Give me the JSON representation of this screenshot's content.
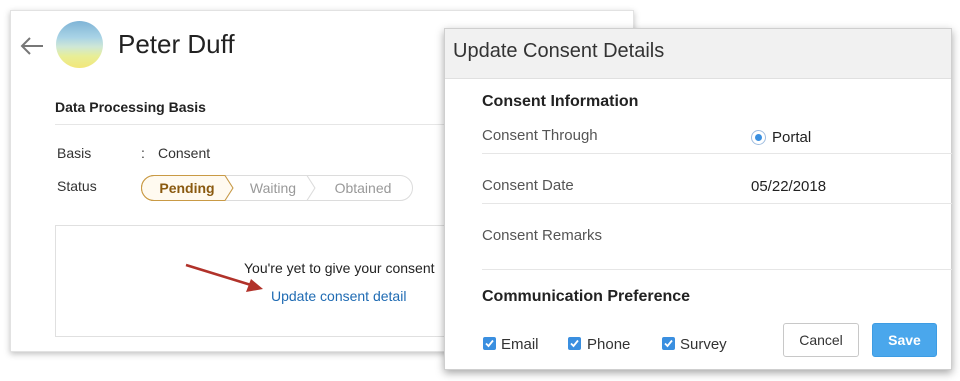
{
  "profile": {
    "name": "Peter Duff",
    "section_title": "Data Processing Basis",
    "basis_label": "Basis",
    "basis_colon": ":",
    "basis_value": "Consent",
    "status_label": "Status",
    "status_stages": [
      "Pending",
      "Waiting",
      "Obtained"
    ],
    "active_stage": "Pending",
    "consent_message": "You're yet to give your consent",
    "consent_link": "Update consent detail"
  },
  "dialog": {
    "title": "Update Consent Details",
    "consent_info_heading": "Consent Information",
    "consent_through_label": "Consent Through",
    "consent_through_value": "Portal",
    "consent_date_label": "Consent Date",
    "consent_date_value": "05/22/2018",
    "consent_remarks_label": "Consent Remarks",
    "comm_pref_heading": "Communication Preference",
    "preferences": [
      {
        "label": "Email",
        "checked": true
      },
      {
        "label": "Phone",
        "checked": true
      },
      {
        "label": "Survey",
        "checked": true
      }
    ],
    "cancel_label": "Cancel",
    "save_label": "Save"
  },
  "colors": {
    "accent": "#3a8fe0",
    "save_button": "#4aa7ec",
    "link": "#1f6bb3",
    "pending_stage": "#8a5a10",
    "pointer_arrow": "#b1322a"
  },
  "icons": {
    "back": "arrow-left-icon",
    "avatar": "avatar",
    "radio": "radio-selected-icon",
    "checkbox": "checkbox-checked-icon",
    "pointer": "red-pointer-arrow-icon"
  }
}
